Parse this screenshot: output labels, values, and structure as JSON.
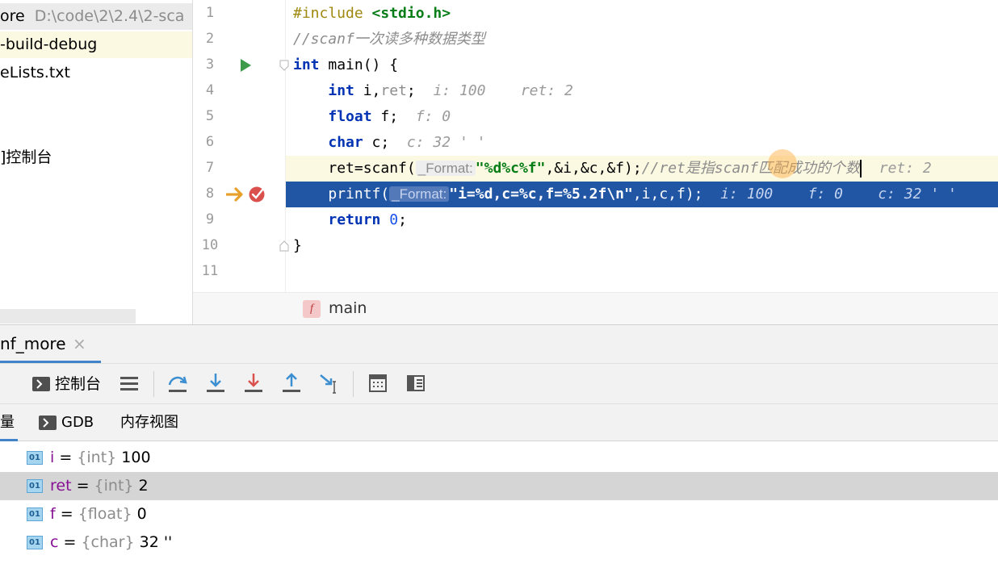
{
  "project": {
    "rows": [
      {
        "label": "ore",
        "path": "D:\\code\\2\\2.4\\2-sca"
      },
      {
        "label": "-build-debug"
      },
      {
        "label": "eLists.txt"
      },
      {
        "label": "]控制台"
      }
    ]
  },
  "editor": {
    "line_numbers": [
      "1",
      "2",
      "3",
      "4",
      "5",
      "6",
      "7",
      "8",
      "9",
      "10",
      "11"
    ],
    "line1": {
      "directive": "#include ",
      "header": "<stdio.h>"
    },
    "line2": {
      "comment": "//scanf一次读多种数据类型"
    },
    "line3": {
      "kw": "int",
      "rest": " main() {"
    },
    "line4": {
      "kw": "int",
      "rest": " i,",
      "var": "ret",
      "semi": ";",
      "inlay1": "i: 100",
      "inlay2": "ret: 2"
    },
    "line5": {
      "kw": "float",
      "rest": " f;",
      "inlay": "f: 0"
    },
    "line6": {
      "kw": "char",
      "rest": " c;",
      "inlay": "c: 32 ' '"
    },
    "line7": {
      "pre": "ret=scanf(",
      "hint": "_Format:",
      "str": "\"%d%c%f\"",
      "args": ",&i,&c,&f);",
      "comment": "//ret是指scanf匹配成功的个数",
      "inlay": "ret: 2"
    },
    "line8": {
      "pre": "printf(",
      "hint": "_Format:",
      "str": "\"i=%d,c=%c,f=%5.2f\\n\"",
      "args": ",i,c,f);",
      "inlay1": "i: 100",
      "inlay2": "f: 0",
      "inlay3": "c: 32 ' '"
    },
    "line9": {
      "kw": "return",
      "sp": " ",
      "num": "0",
      "semi": ";"
    },
    "line10": {
      "text": "}"
    },
    "breadcrumb_icon": "f",
    "breadcrumb": "main"
  },
  "debug": {
    "tab_label": "nf_more",
    "tab_close": "×",
    "toolbar": {
      "console_label": "控制台",
      "icons": [
        "console-icon",
        "menu-icon",
        "step-over-icon",
        "step-into-icon",
        "force-step-into-icon",
        "step-out-icon",
        "run-to-cursor-icon",
        "evaluate-icon",
        "memory-layout-icon"
      ]
    },
    "var_tabs": {
      "left_fragment": "量",
      "gdb": "GDB",
      "memory": "内存视图"
    },
    "variables": [
      {
        "name": "i",
        "eq": " = ",
        "type": "{int}",
        "value": " 100"
      },
      {
        "name": "ret",
        "eq": " = ",
        "type": "{int}",
        "value": " 2"
      },
      {
        "name": "f",
        "eq": " = ",
        "type": "{float}",
        "value": " 0"
      },
      {
        "name": "c",
        "eq": " = ",
        "type": "{char}",
        "value": " 32 ''"
      }
    ],
    "var_icon_label": "01"
  },
  "colors": {
    "execution_line": "#2156a5",
    "current_line": "#fcf9e2",
    "keyword": "#0033b3",
    "string": "#067d17",
    "selected_var": "#d5d5d5"
  }
}
